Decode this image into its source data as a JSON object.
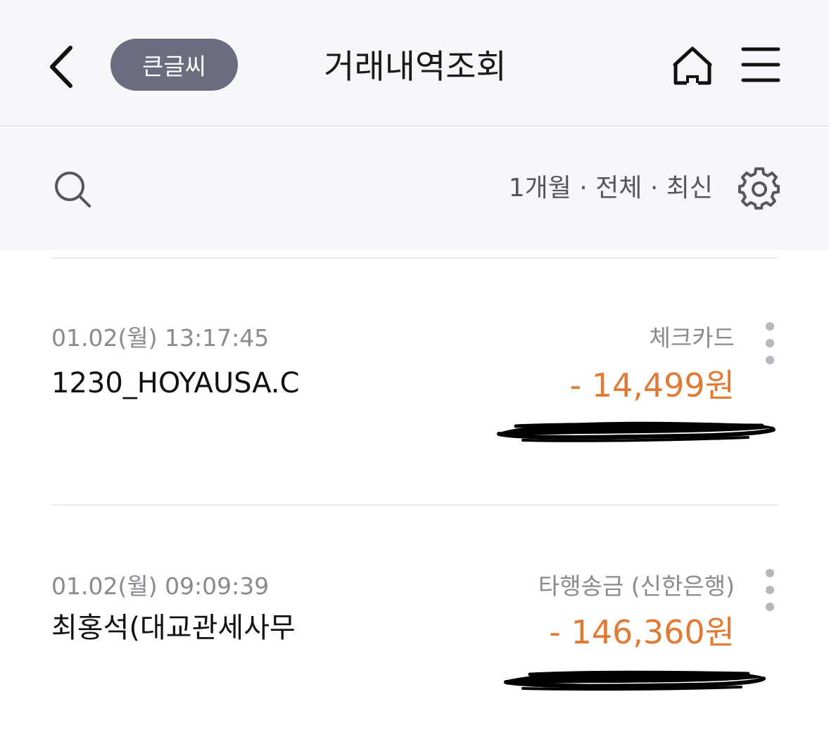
{
  "header": {
    "back_icon": "chevron-left-icon",
    "big_text_label": "큰글씨",
    "title": "거래내역조회",
    "home_icon": "home-icon",
    "menu_icon": "hamburger-menu-icon"
  },
  "filter": {
    "search_icon": "search-icon",
    "summary": "1개월 · 전체 · 최신",
    "settings_icon": "gear-icon"
  },
  "transactions": [
    {
      "datetime": "01.02(월) 13:17:45",
      "merchant": "1230_HOYAUSA.C",
      "type": "체크카드",
      "amount": "- 14,499원"
    },
    {
      "datetime": "01.02(월) 09:09:39",
      "merchant": "최홍석(대교관세사무",
      "type": "타행송금 (신한은행)",
      "amount": "- 146,360원"
    }
  ],
  "colors": {
    "header_bg": "#f7f7f9",
    "badge_bg": "#6b6c7e",
    "amount": "#e07a35",
    "secondary_text": "#8a8a8e"
  }
}
